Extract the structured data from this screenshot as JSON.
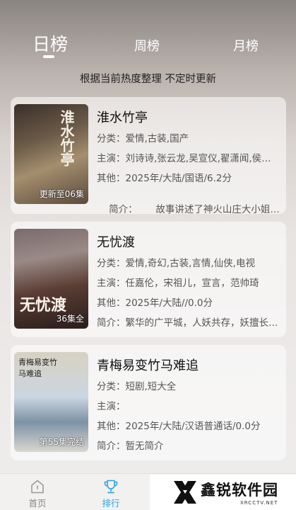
{
  "tabs": {
    "day": "日榜",
    "week": "周榜",
    "month": "月榜"
  },
  "subtitle": "根据当前热度整理 不定时更新",
  "items": [
    {
      "title": "淮水竹亭",
      "poster_text": "淮水竹亭",
      "badge": "更新至06集",
      "genre_label": "分类：",
      "genre": "爱情,古装,国产",
      "cast_label": "主演：",
      "cast": "刘诗诗,张云龙,吴宣仪,翟潇闻,侯…",
      "other_label": "其他：",
      "other": "2025年/大陆/国语/6.2分",
      "intro_label": "简介：",
      "intro": "      故事讲述了神火山庄大小姐东…"
    },
    {
      "title": "无忧渡",
      "poster_text": "无忧渡",
      "badge": "36集全",
      "genre_label": "分类：",
      "genre": "爱情,奇幻,古装,言情,仙侠,电视",
      "cast_label": "主演：",
      "cast": "任嘉伦，宋祖儿，宣言，范帅琦",
      "other_label": "其他：",
      "other": "2025年/大陆//0.0分",
      "intro_label": "简介：",
      "intro": "繁华的广平城，人妖共存，妖擅长…"
    },
    {
      "title": "青梅易变竹马难追",
      "poster_text": "青梅易变竹马难追",
      "badge": "第55集完结",
      "genre_label": "分类：",
      "genre": "短剧,短大全",
      "cast_label": "主演：",
      "cast": "",
      "other_label": "其他：",
      "other": "2025年/大陆/汉语普通话/0.0分",
      "intro_label": "简介：",
      "intro": "暂无简介"
    }
  ],
  "nav": {
    "home": "首页",
    "rank": "排行"
  },
  "watermark": {
    "text": "鑫锐软件园",
    "sub": "XRCCTV.NET"
  },
  "colors": {
    "accent": "#2ba4e6",
    "inactive": "#8a8a8a"
  }
}
